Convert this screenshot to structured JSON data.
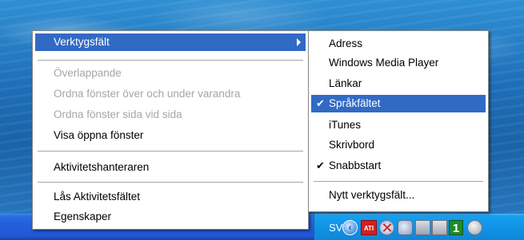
{
  "context_menu": {
    "items": [
      {
        "label": "Verktygsfält",
        "state": "highlighted",
        "has_submenu": true
      },
      {
        "label": "Överlappande",
        "state": "disabled"
      },
      {
        "label": "Ordna fönster över och under varandra",
        "state": "disabled"
      },
      {
        "label": "Ordna fönster sida vid sida",
        "state": "disabled"
      },
      {
        "label": "Visa öppna fönster",
        "state": "enabled"
      },
      {
        "label": "Aktivitetshanteraren",
        "state": "enabled"
      },
      {
        "label": "Lås Aktivitetsfältet",
        "state": "enabled"
      },
      {
        "label": "Egenskaper",
        "state": "enabled"
      }
    ]
  },
  "toolbars_submenu": {
    "items": [
      {
        "label": "Adress",
        "checked": false
      },
      {
        "label": "Windows Media Player",
        "checked": false
      },
      {
        "label": "Länkar",
        "checked": false
      },
      {
        "label": "Språkfältet",
        "checked": true,
        "state": "highlighted"
      },
      {
        "label": "iTunes",
        "checked": false
      },
      {
        "label": "Skrivbord",
        "checked": false
      },
      {
        "label": "Snabbstart",
        "checked": true
      },
      {
        "label": "Nytt verktygsfält...",
        "checked": false
      }
    ],
    "check_glyph": "✔"
  },
  "taskbar": {
    "language_indicator": "SV",
    "chevron_glyph": "‹",
    "ati_label": "ATI",
    "onenote_label": "1"
  },
  "colors": {
    "highlight": "#316ac5",
    "disabled_text": "#a6a6a6",
    "taskbar_blue": "#245edb",
    "tray_blue": "#1193e6"
  }
}
